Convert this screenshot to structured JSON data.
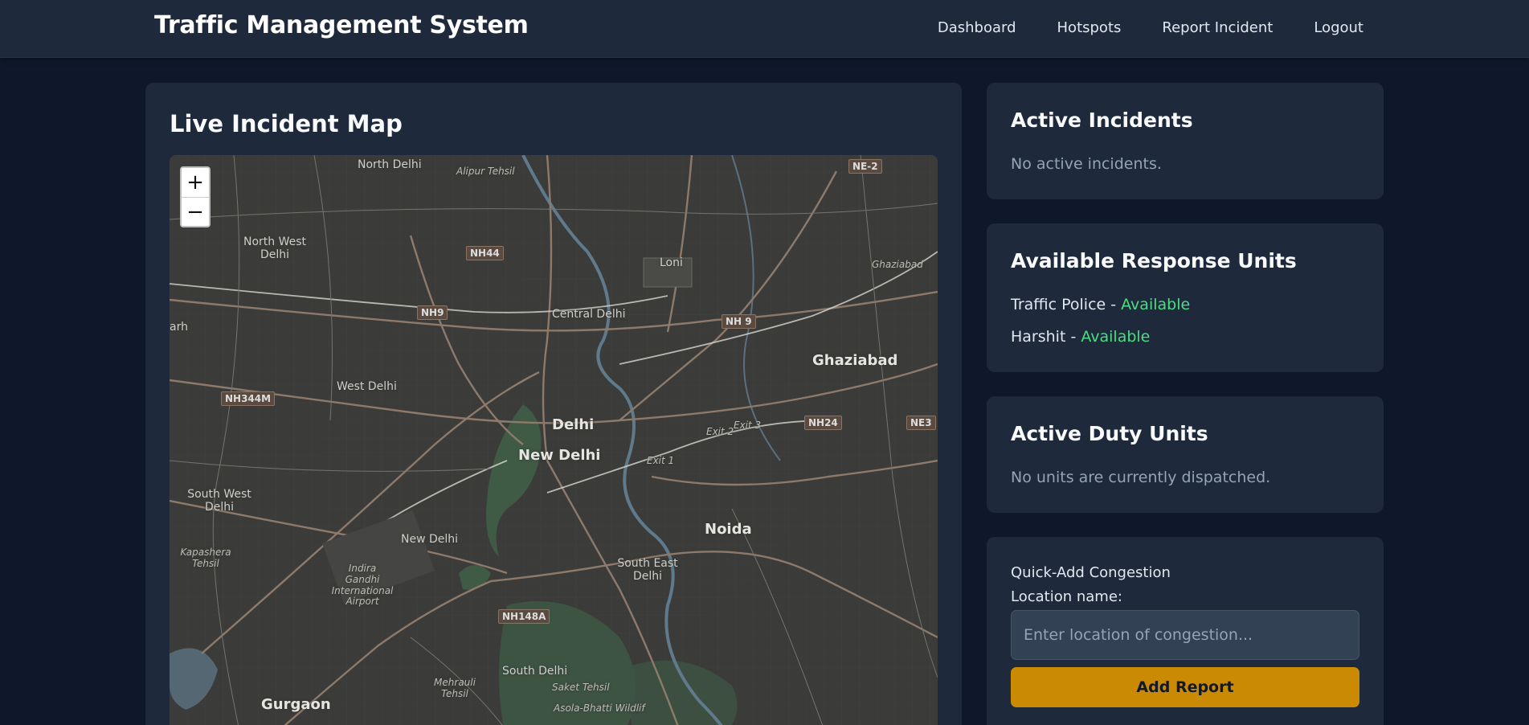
{
  "header": {
    "brand": "Traffic Management System",
    "nav": [
      "Dashboard",
      "Hotspots",
      "Report Incident",
      "Logout"
    ]
  },
  "map_panel": {
    "title": "Live Incident Map",
    "zoom_in": "+",
    "zoom_out": "−",
    "labels": {
      "north_delhi": "North Delhi",
      "alipur": "Alipur Tehsil",
      "north_west_delhi": "North West Delhi",
      "loni": "Loni",
      "ghaziabad_it": "Ghaziabad",
      "central_delhi": "Central Delhi",
      "ghaziabad": "Ghaziabad",
      "west_delhi": "West Delhi",
      "delhi": "Delhi",
      "new_delhi": "New Delhi",
      "exit1": "Exit 1",
      "exit2": "Exit 2",
      "exit3": "Exit 3",
      "south_west_delhi": "South West Delhi",
      "new_delhi2": "New Delhi",
      "noida": "Noida",
      "kapashera": "Kapashera Tehsil",
      "igi": "Indira Gandhi International Airport",
      "south_east_delhi": "South East Delhi",
      "south_delhi": "South Delhi",
      "saket": "Saket Tehsil",
      "mehrauli": "Mehrauli Tehsil",
      "gurgaon": "Gurgaon",
      "asola": "Asola-Bhatti Wildlif",
      "arh": "arh"
    },
    "shields": {
      "ne2": "NE-2",
      "nh44": "NH44",
      "nh9a": "NH9",
      "nh9b": "NH 9",
      "nh344m": "NH344M",
      "nh24": "NH24",
      "ne3": "NE3",
      "nh148a": "NH148A"
    }
  },
  "active_incidents": {
    "title": "Active Incidents",
    "empty": "No active incidents."
  },
  "response_units": {
    "title": "Available Response Units",
    "units": [
      {
        "name": "Traffic Police",
        "sep": " - ",
        "status": "Available"
      },
      {
        "name": "Harshit",
        "sep": " - ",
        "status": "Available"
      }
    ]
  },
  "duty_units": {
    "title": "Active Duty Units",
    "empty": "No units are currently dispatched."
  },
  "quick_add": {
    "title": "Quick-Add Congestion",
    "field_label": "Location name:",
    "placeholder": "Enter location of congestion...",
    "button": "Add Report"
  },
  "colors": {
    "page_bg": "#0f172a",
    "card_bg": "#1e293b",
    "accent_button": "#ca8a04",
    "available": "#4ade80"
  }
}
